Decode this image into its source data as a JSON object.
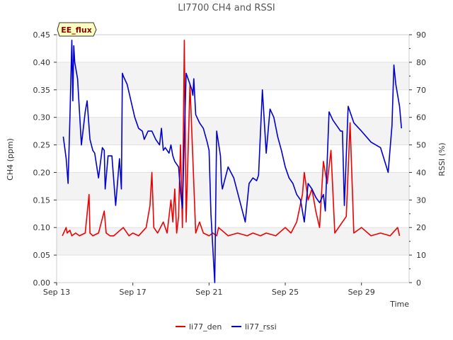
{
  "chart_data": {
    "type": "line",
    "title": "LI7700 CH4 and RSSI",
    "xlabel": "Time",
    "ylabel_left": "CH4 (ppm)",
    "ylabel_right": "RSSI (%)",
    "badge": "EE_flux",
    "x_ticks": [
      "Sep 13",
      "Sep 17",
      "Sep 21",
      "Sep 25",
      "Sep 29"
    ],
    "x_tick_days": [
      13,
      17,
      21,
      25,
      29
    ],
    "xlim_days": [
      13,
      31.5
    ],
    "ylim_left": [
      0,
      0.45
    ],
    "ylim_right": [
      0,
      90
    ],
    "yticks_left": [
      "0.00",
      "0.05",
      "0.10",
      "0.15",
      "0.20",
      "0.25",
      "0.30",
      "0.35",
      "0.40",
      "0.45"
    ],
    "yticks_right": [
      "0",
      "10",
      "20",
      "30",
      "40",
      "50",
      "60",
      "70",
      "80",
      "90"
    ],
    "grid": true,
    "legend_position": "bottom-center",
    "series": [
      {
        "name": "li77_den",
        "axis": "left",
        "color": "#ee0000",
        "x": [
          13.3,
          13.5,
          13.55,
          13.7,
          13.8,
          14.0,
          14.2,
          14.5,
          14.7,
          14.75,
          14.9,
          15.2,
          15.5,
          15.6,
          15.8,
          16.0,
          16.5,
          16.8,
          17.0,
          17.3,
          17.7,
          17.9,
          18.0,
          18.1,
          18.3,
          18.6,
          18.8,
          19.0,
          19.1,
          19.2,
          19.3,
          19.4,
          19.5,
          19.6,
          19.7,
          19.8,
          20.0,
          20.3,
          20.5,
          20.7,
          21.0,
          21.2,
          21.4,
          21.5,
          22.0,
          22.5,
          23.0,
          23.3,
          23.7,
          24.0,
          24.5,
          25.0,
          25.3,
          25.6,
          25.9,
          26.0,
          26.2,
          26.4,
          26.6,
          26.8,
          27.0,
          27.2,
          27.4,
          27.6,
          28.0,
          28.2,
          28.4,
          28.6,
          29.0,
          29.5,
          30.0,
          30.5,
          30.9,
          31.0
        ],
        "y": [
          0.085,
          0.1,
          0.09,
          0.095,
          0.085,
          0.09,
          0.085,
          0.09,
          0.16,
          0.09,
          0.085,
          0.09,
          0.13,
          0.09,
          0.085,
          0.085,
          0.1,
          0.085,
          0.09,
          0.085,
          0.1,
          0.14,
          0.2,
          0.1,
          0.09,
          0.11,
          0.09,
          0.15,
          0.11,
          0.17,
          0.09,
          0.12,
          0.25,
          0.1,
          0.44,
          0.11,
          0.36,
          0.09,
          0.11,
          0.09,
          0.085,
          0.09,
          0.085,
          0.1,
          0.085,
          0.09,
          0.085,
          0.09,
          0.085,
          0.09,
          0.085,
          0.1,
          0.09,
          0.11,
          0.16,
          0.2,
          0.15,
          0.17,
          0.13,
          0.1,
          0.22,
          0.18,
          0.24,
          0.09,
          0.11,
          0.12,
          0.29,
          0.09,
          0.1,
          0.085,
          0.09,
          0.085,
          0.1,
          0.085
        ]
      },
      {
        "name": "li77_rssi",
        "axis": "right",
        "color": "#0000cc",
        "x": [
          13.35,
          13.5,
          13.6,
          13.7,
          13.8,
          13.85,
          13.9,
          13.95,
          14.1,
          14.3,
          14.5,
          14.6,
          14.75,
          14.9,
          15.0,
          15.2,
          15.4,
          15.5,
          15.55,
          15.7,
          15.9,
          16.1,
          16.3,
          16.4,
          16.45,
          16.5,
          16.7,
          16.9,
          17.1,
          17.3,
          17.5,
          17.6,
          17.8,
          18.0,
          18.2,
          18.4,
          18.5,
          18.6,
          18.7,
          18.9,
          19.0,
          19.1,
          19.2,
          19.4,
          19.5,
          19.6,
          19.8,
          20.0,
          20.1,
          20.15,
          20.2,
          20.3,
          20.5,
          20.7,
          20.9,
          21.0,
          21.1,
          21.3,
          21.4,
          21.6,
          21.65,
          21.7,
          22.0,
          22.3,
          22.6,
          22.9,
          23.1,
          23.3,
          23.5,
          23.6,
          23.8,
          24.0,
          24.2,
          24.4,
          24.6,
          24.8,
          25.0,
          25.2,
          25.4,
          25.6,
          25.8,
          26.0,
          26.2,
          26.4,
          26.6,
          26.8,
          27.0,
          27.1,
          27.3,
          27.5,
          27.7,
          27.9,
          28.0,
          28.1,
          28.3,
          28.6,
          29.0,
          29.5,
          30.0,
          30.4,
          30.6,
          30.7,
          30.8,
          31.0,
          31.1
        ],
        "y": [
          53,
          45,
          36,
          60,
          88,
          66,
          86,
          80,
          74,
          50,
          62,
          66,
          52,
          48,
          47,
          38,
          49,
          48,
          34,
          46,
          46,
          28,
          45,
          34,
          76,
          75,
          72,
          66,
          60,
          56,
          55,
          52,
          55,
          55,
          52,
          50,
          56,
          48,
          49,
          47,
          50,
          46,
          44,
          42,
          33,
          27,
          76,
          72,
          70,
          68,
          74,
          61,
          58,
          56,
          51,
          48,
          25,
          0,
          55,
          46,
          37,
          34,
          42,
          38,
          30,
          22,
          36,
          38,
          37,
          39,
          70,
          47,
          63,
          60,
          53,
          48,
          42,
          38,
          36,
          32,
          30,
          22,
          36,
          34,
          31,
          29,
          32,
          26,
          62,
          59,
          57,
          55,
          55,
          28,
          64,
          58,
          55,
          51,
          49,
          40,
          57,
          79,
          72,
          64,
          56
        ]
      }
    ]
  }
}
